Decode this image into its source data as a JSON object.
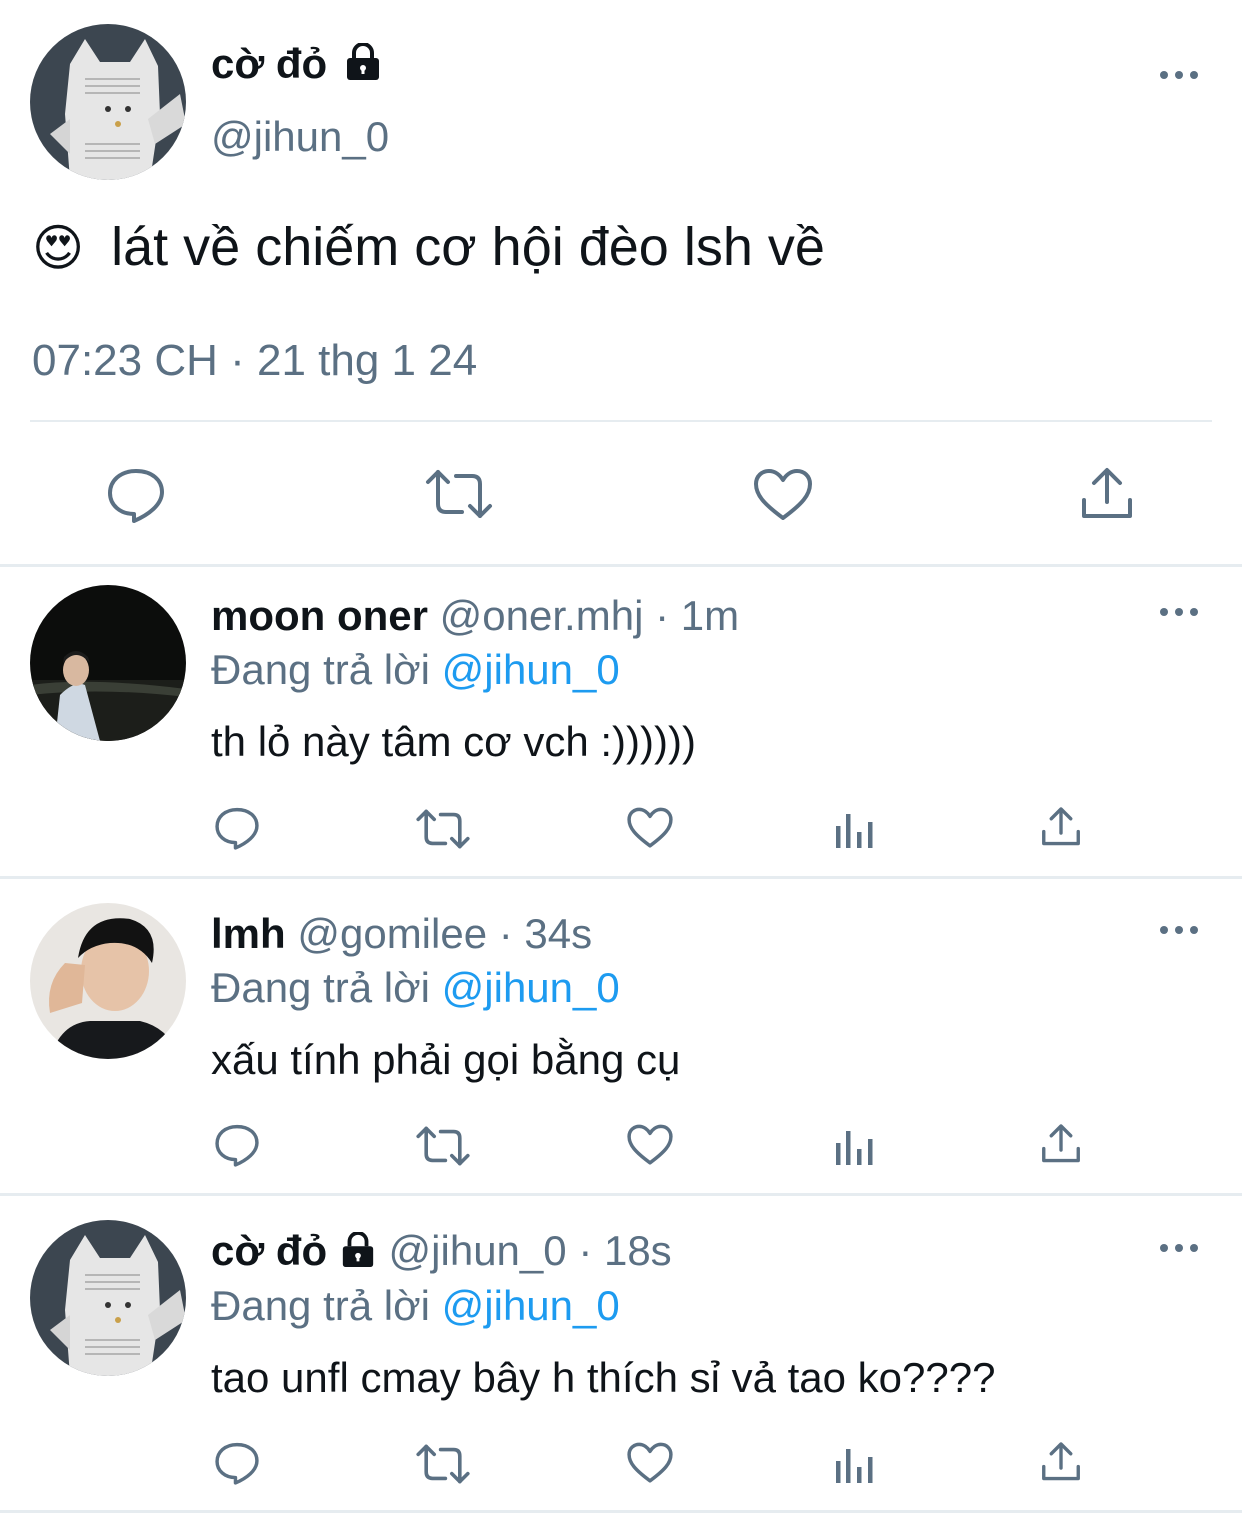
{
  "main_tweet": {
    "display_name": "cờ đỏ",
    "handle": "@jihun_0",
    "emoji": "😍",
    "text": "lát về chiếm cơ hội đèo lsh về",
    "timestamp": "07:23 CH · 21 thg 1 24",
    "actions": [
      "reply-icon",
      "retweet-icon",
      "like-icon",
      "share-icon"
    ]
  },
  "replies": [
    {
      "display_name": "moon oner",
      "handle": "@oner.mhj",
      "time": "· 1m",
      "replying_prefix": "Đang trả lời",
      "replying_to": "@jihun_0",
      "text": "th lỏ này tâm cơ vch :))))))",
      "locked": false
    },
    {
      "display_name": "lmh",
      "handle": "@gomilee",
      "time": "· 34s",
      "replying_prefix": "Đang trả lời",
      "replying_to": "@jihun_0",
      "text": "xấu tính phải gọi bằng cụ",
      "locked": false
    },
    {
      "display_name": "cờ đỏ",
      "handle": "@jihun_0",
      "time": "· 18s",
      "replying_prefix": "Đang trả lời",
      "replying_to": "@jihun_0",
      "text": "tao unfl cmay bây h thích sỉ vả tao ko????",
      "locked": true
    }
  ],
  "colors": {
    "text": "#0f1419",
    "secondary": "#5b7083",
    "link": "#1d9bf0",
    "divider": "#e6ecf0"
  }
}
